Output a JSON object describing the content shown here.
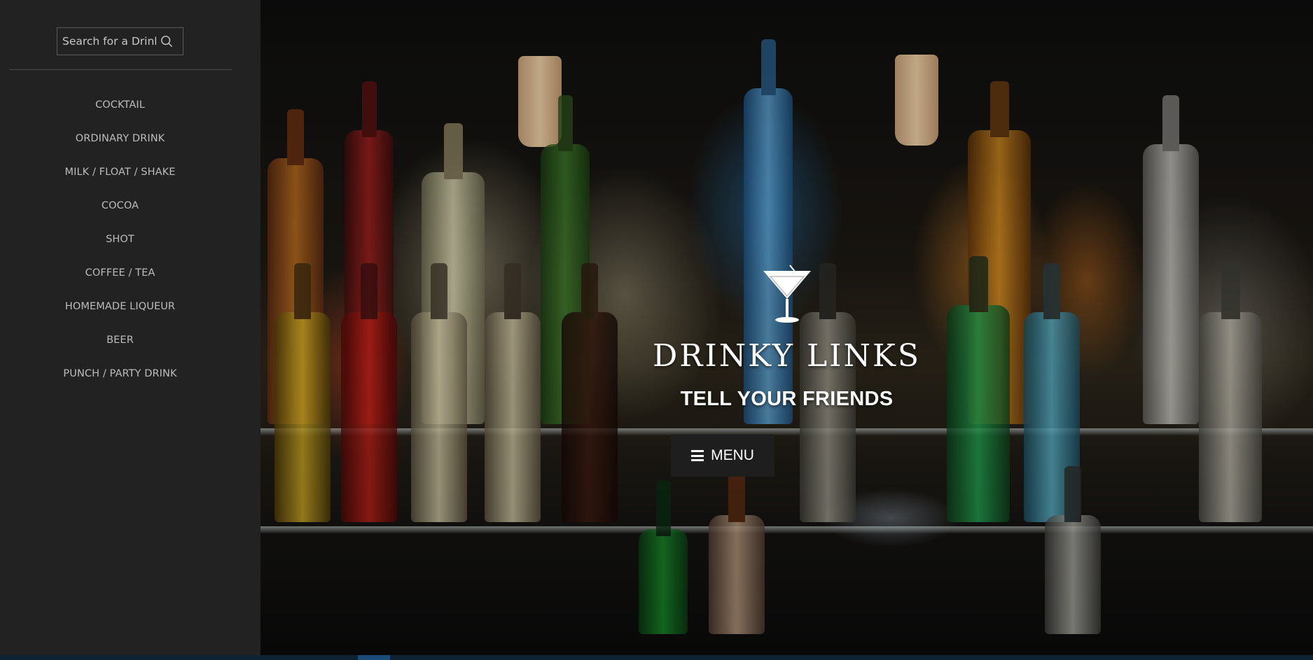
{
  "sidebar": {
    "search": {
      "placeholder": "Search for a Drink"
    },
    "items": [
      {
        "label": "COCKTAIL"
      },
      {
        "label": "ORDINARY DRINK"
      },
      {
        "label": "MILK / FLOAT / SHAKE"
      },
      {
        "label": "COCOA"
      },
      {
        "label": "SHOT"
      },
      {
        "label": "COFFEE / TEA"
      },
      {
        "label": "HOMEMADE LIQUEUR"
      },
      {
        "label": "BEER"
      },
      {
        "label": "PUNCH / PARTY DRINK"
      }
    ]
  },
  "hero": {
    "title": "DRINKY LINKS",
    "tagline": "TELL YOUR FRIENDS",
    "menu_label": "MENU",
    "logo_icon": "martini-glass-icon"
  },
  "colors": {
    "sidebar_bg": "#222222",
    "nav_text": "#bcbcbc",
    "menu_button_bg": "#1e1e1e",
    "taskbar": "#0e2233"
  }
}
